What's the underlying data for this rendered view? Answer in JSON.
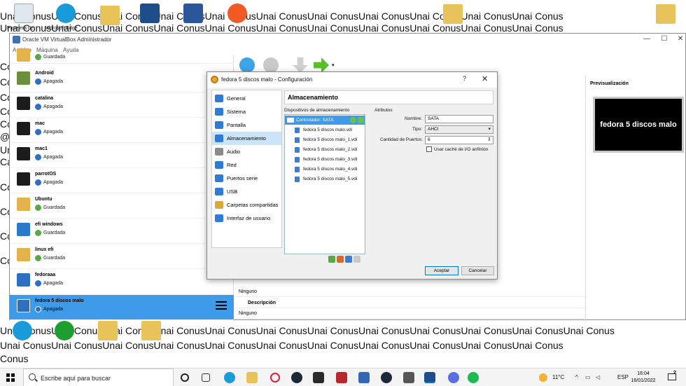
{
  "desktop": {
    "lines": [
      "Unai ConusUnai ConusUnai ConusUnai ConusUnai ConusUnai ConusUnai ConusUnai ConusUnai ConusUnai ConusUnai Conus",
      "Unai ConusUnai ConusUnai ConusUnai ConusUnai ConusUnai ConusUnai ConusUnai ConusUnai ConusUnai ConusUnai Conus",
      "Unai ConusUnai ConusUnai ConusUnai ConusUnai ConusUnai ConusUnai ConusUnai ConusUnai ConusUnai ConusUnai ConusUnai Conus",
      "Unai ConusUnai ConusUnai ConusUnai ConusUnai ConusUnai ConusUnai ConusUnai ConusUnai ConusUnai ConusUnai Conus",
      "Conus"
    ],
    "left_fragments": [
      "Co",
      "Co",
      "Co",
      "Co",
      "Co",
      "Co",
      "Co",
      "Co",
      "@",
      "Un",
      "Ca",
      "Co",
      "Co",
      "Co",
      "Co"
    ],
    "icon_labels": [
      "Papelera de",
      "Microsoft Edge",
      "Unai Conus",
      "VirtualBox",
      "Microsoft Word",
      "Origin",
      "Unai Conus",
      "Unai Conus"
    ]
  },
  "vbox": {
    "title": "Oracle VM VirtualBox Administrador",
    "menu": [
      "Archivo",
      "Máquina",
      "Ayuda"
    ],
    "vms": [
      {
        "name": "",
        "state": "Guardada",
        "badge": "2.6"
      },
      {
        "name": "Android",
        "state": "Apagada",
        "badge": "64"
      },
      {
        "name": "catalina",
        "state": "Apagada",
        "badge": "64"
      },
      {
        "name": "mac",
        "state": "Apagada",
        "badge": "64"
      },
      {
        "name": "mac1",
        "state": "Apagada",
        "badge": "64"
      },
      {
        "name": "parrotOS",
        "state": "Apagada",
        "badge": "64"
      },
      {
        "name": "Ubuntu",
        "state": "Guardada",
        "badge": "64"
      },
      {
        "name": "efi windows",
        "state": "Guardada",
        "badge": "64"
      },
      {
        "name": "linux efi",
        "state": "Guardada",
        "badge": "2.6"
      },
      {
        "name": "fedoraaa",
        "state": "Apagada",
        "badge": "64"
      },
      {
        "name": "fedora 5 discos malo",
        "state": "Apagada",
        "badge": "64"
      }
    ],
    "details": {
      "ninguno_1": "Ninguno",
      "descripcion_header": "Descripción",
      "ninguno_2": "Ninguno"
    },
    "preview": {
      "header": "Previsualización",
      "screen_text": "fedora 5 discos malo"
    }
  },
  "dialog": {
    "title": "fedora 5 discos malo - Configuración",
    "help": "?",
    "nav": [
      {
        "label": "General",
        "color": "#2f7bd6"
      },
      {
        "label": "Sistema",
        "color": "#2f7bd6"
      },
      {
        "label": "Pantalla",
        "color": "#2f7bd6"
      },
      {
        "label": "Almacenamiento",
        "color": "#2f7bd6"
      },
      {
        "label": "Audio",
        "color": "#8a8a8a"
      },
      {
        "label": "Red",
        "color": "#2f7bd6"
      },
      {
        "label": "Puertos serie",
        "color": "#2f7bd6"
      },
      {
        "label": "USB",
        "color": "#2f7bd6"
      },
      {
        "label": "Carpetas compartidas",
        "color": "#d9a93a"
      },
      {
        "label": "Interfaz de usuario",
        "color": "#2f7bd6"
      }
    ],
    "section_title": "Almacenamiento",
    "devices_label": "Dispositivos de almacenamiento",
    "attributes_label": "Atributos",
    "controller": "Controlador: SATA",
    "disks": [
      "fedora 5 discos malo.vdi",
      "fedora 5 discos malo_1.vdi",
      "fedora 5 discos malo_2.vdi",
      "fedora 5 discos malo_3.vdi",
      "fedora 5 discos malo_4.vdi",
      "fedora 5 discos malo_5.vdi"
    ],
    "attrs": {
      "name_label": "Nombre:",
      "name_value": "SATA",
      "type_label": "Tipo:",
      "type_value": "AHCI",
      "ports_label": "Cantidad de Puertos:",
      "ports_value": "6",
      "cache_label": "Usar caché de I/O anfitrión"
    },
    "accept": "Aceptar",
    "cancel": "Cancelar"
  },
  "taskbar": {
    "search_placeholder": "Escribe aquí para buscar",
    "temperature": "11°C",
    "lang": "ESP",
    "time": "16:04",
    "date": "16/01/2022",
    "notif_count": "2"
  }
}
